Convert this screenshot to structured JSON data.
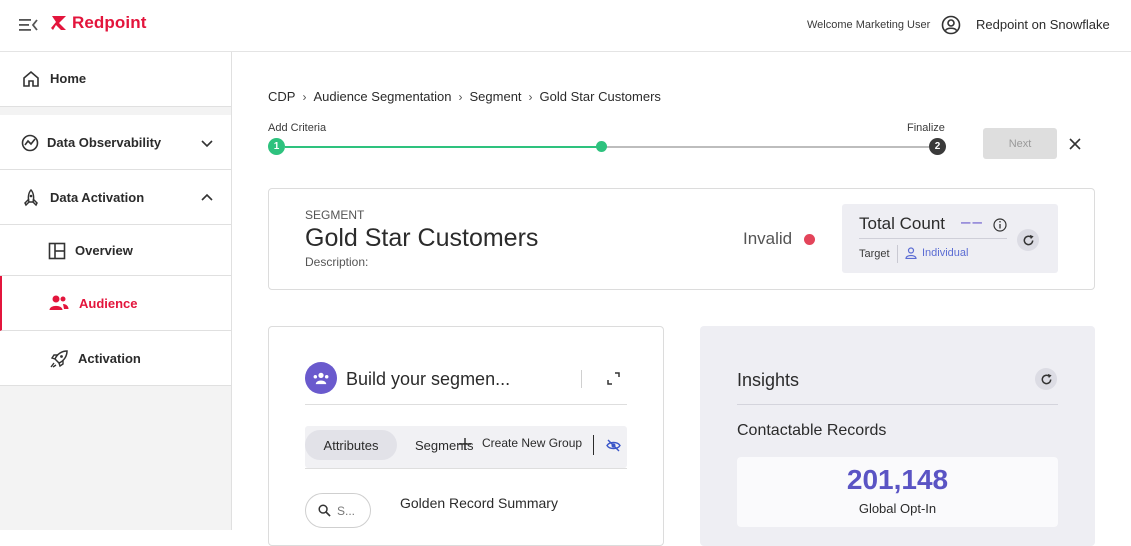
{
  "header": {
    "brand": "Redpoint",
    "welcome": "Welcome Marketing User",
    "tenant": "Redpoint on Snowflake",
    "brand_color": "#e3153c"
  },
  "sidebar": {
    "items": [
      {
        "label": "Home",
        "icon": "home-icon"
      },
      {
        "label": "Data Observability",
        "icon": "chart-circle-icon",
        "expanded": false
      },
      {
        "label": "Data Activation",
        "icon": "rocket-icon",
        "expanded": true
      },
      {
        "label": "Overview",
        "icon": "layout-icon"
      },
      {
        "label": "Audience",
        "icon": "users-icon",
        "active": true
      },
      {
        "label": "Activation",
        "icon": "rocket-launch-icon"
      }
    ]
  },
  "breadcrumb": [
    "CDP",
    "Audience Segmentation",
    "Segment",
    "Gold Star Customers"
  ],
  "stepper": {
    "start_label": "Add Criteria",
    "end_label": "Finalize",
    "start_number": "1",
    "end_number": "2",
    "next_label": "Next",
    "active_color": "#2ec27e"
  },
  "segment": {
    "kicker": "SEGMENT",
    "name": "Gold Star Customers",
    "description_label": "Description:",
    "status": "Invalid",
    "total_count_label": "Total Count",
    "total_count_value": "––",
    "target_label": "Target",
    "target_value": "Individual"
  },
  "builder": {
    "title": "Build your segmen...",
    "tabs": [
      "Attributes",
      "Segments"
    ],
    "create_group_label": "Create New Group",
    "search_placeholder": "S...",
    "section_title": "Golden Record Summary"
  },
  "insights": {
    "title": "Insights",
    "subtitle": "Contactable Records",
    "stat_value": "201,148",
    "stat_label": "Global Opt-In",
    "accent_color": "#5a54c4"
  }
}
